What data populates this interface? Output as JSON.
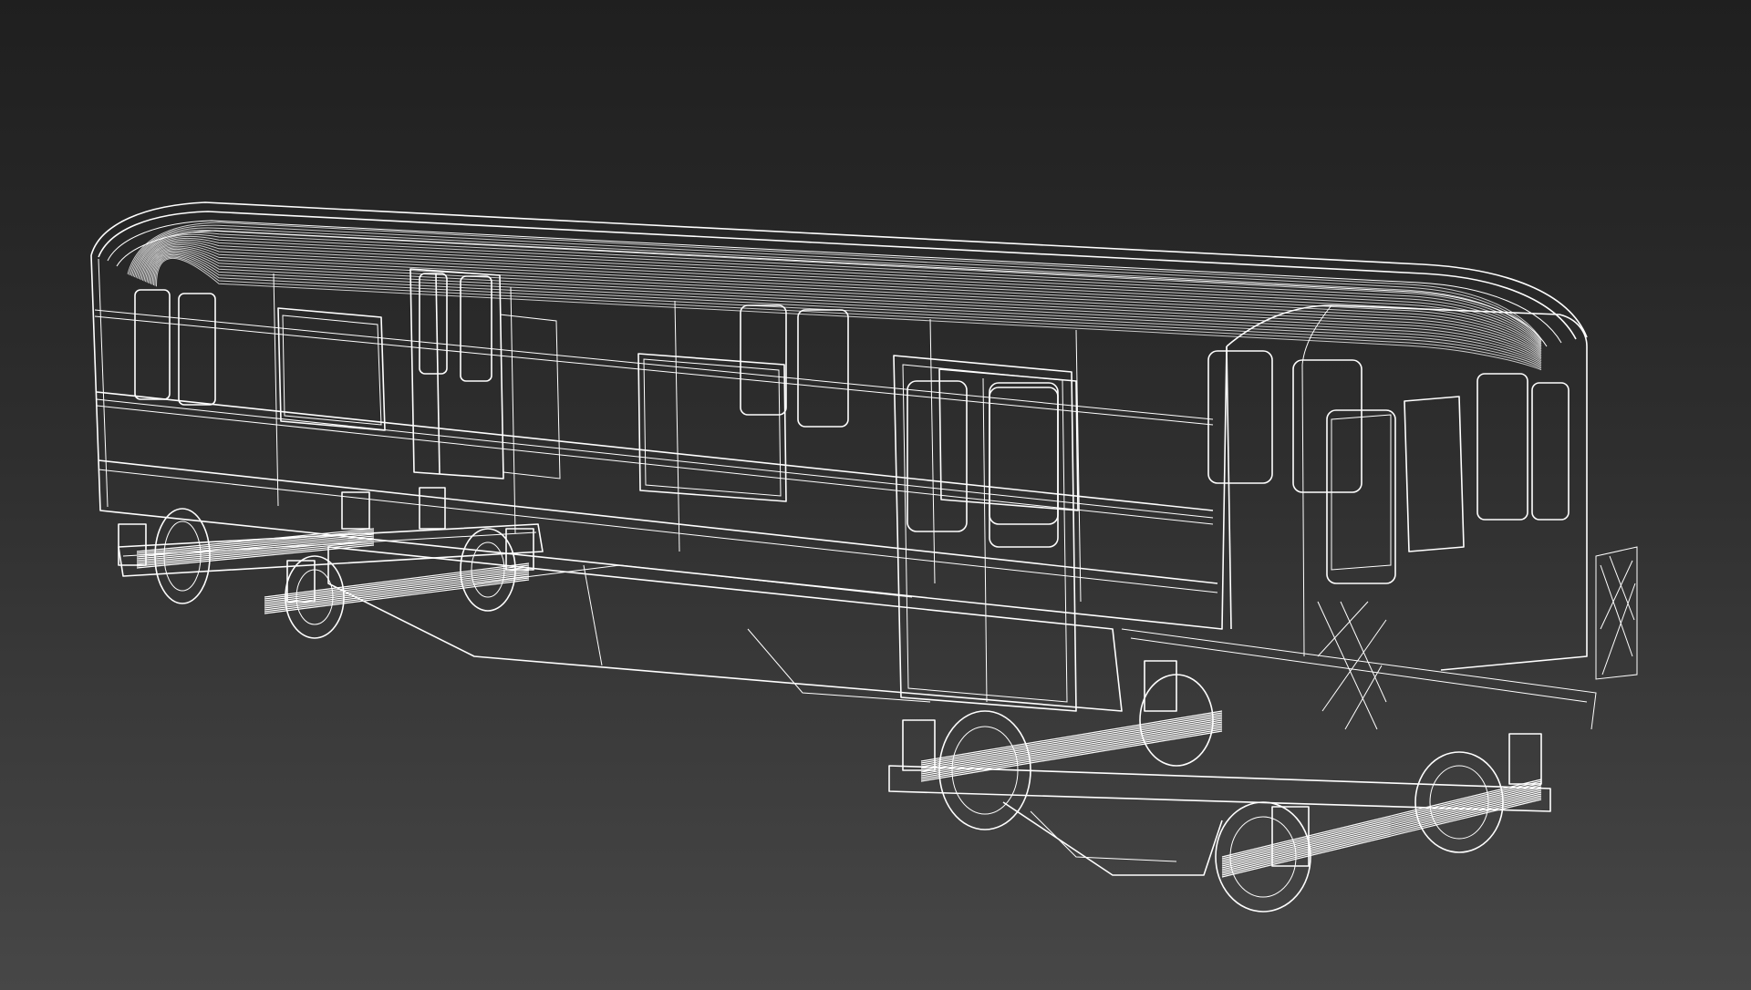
{
  "viewport": {
    "background_top": "#1f1f1f",
    "background_bottom": "#474747",
    "wire_color": "#ffffff",
    "render_mode": "wireframe"
  },
  "model": {
    "subject-icon": "subway-car-wireframe"
  }
}
